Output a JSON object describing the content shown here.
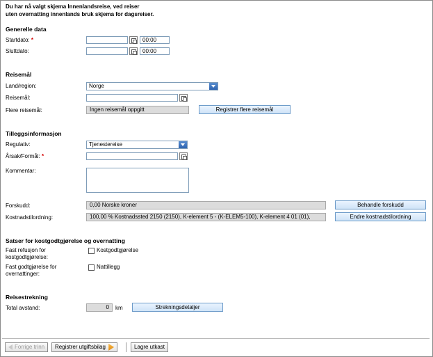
{
  "intro": {
    "line1": "Du har nå valgt skjema Innenlandsreise, ved reiser",
    "line2": "uten overnatting innenlands bruk skjema for dagsreiser."
  },
  "general": {
    "heading": "Generelle data",
    "start_label": "Startdato:",
    "required_mark": "*",
    "start_date": "",
    "start_time": "00:00",
    "end_label": "Sluttdato:",
    "end_date": "",
    "end_time": "00:00"
  },
  "destination": {
    "heading": "Reisemål",
    "country_label": "Land/region:",
    "country_value": "Norge",
    "destination_label": "Reisemål:",
    "destination_value": "",
    "more_label": "Flere reisemål:",
    "more_value": "Ingen reisemål oppgitt",
    "register_more_button": "Registrer flere reisemål"
  },
  "additional": {
    "heading": "Tilleggsinformasjon",
    "regulation_label": "Regulativ:",
    "regulation_value": "Tjenestereise",
    "purpose_label": "Årsak/Formål:",
    "purpose_value": "",
    "comment_label": "Kommentar:",
    "comment_value": "",
    "advance_label": "Forskudd:",
    "advance_value": "0,00 Norske kroner",
    "advance_button": "Behandle forskudd",
    "cost_label": "Kostnadstilordning:",
    "cost_value": "100,00 % Kostnadssted 2150 (2150), K-element 5 - (K-ELEM5-100), K-element 4 01 (01),",
    "cost_button": "Endre kostnadstilordning"
  },
  "rates": {
    "heading": "Satser for kostgodtgjørelse og overnatting",
    "fixed_refund_label_1": "Fast refusjon for",
    "fixed_refund_label_2": "kostgodtgjørelse:",
    "fixed_refund_checkbox": "Kostgodtgjørelse",
    "fixed_overnight_label_1": "Fast godtgjørelse for",
    "fixed_overnight_label_2": "overnattinger:",
    "fixed_overnight_checkbox": "Nattillegg"
  },
  "route": {
    "heading": "Reisestrekning",
    "distance_label": "Total avstand:",
    "distance_value": "0",
    "distance_unit": "km",
    "details_button": "Strekningsdetaljer"
  },
  "footer": {
    "prev_button": "Forrige trinn",
    "register_receipts_button": "Registrer utgiftsbilag",
    "save_draft_button": "Lagre utkast"
  }
}
